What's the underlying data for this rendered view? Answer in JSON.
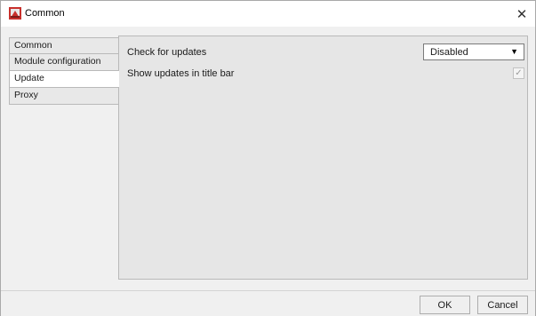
{
  "window": {
    "title": "Common",
    "close_glyph": "✕",
    "app_icon": "app-logo-icon"
  },
  "sidebar": {
    "items": [
      {
        "label": "Common",
        "active": false
      },
      {
        "label": "Module configuration",
        "active": false
      },
      {
        "label": "Update",
        "active": true
      },
      {
        "label": "Proxy",
        "active": false
      }
    ]
  },
  "settings": {
    "check_updates_label": "Check for updates",
    "check_updates_value": "Disabled",
    "dropdown_arrow": "▼",
    "show_updates_label": "Show updates in title bar",
    "show_updates_checked": true,
    "check_glyph": "✓"
  },
  "footer": {
    "ok_label": "OK",
    "cancel_label": "Cancel"
  },
  "colors": {
    "window_bg": "#f0f0f0",
    "panel_bg": "#e6e6e6",
    "icon_red": "#c8302c"
  }
}
